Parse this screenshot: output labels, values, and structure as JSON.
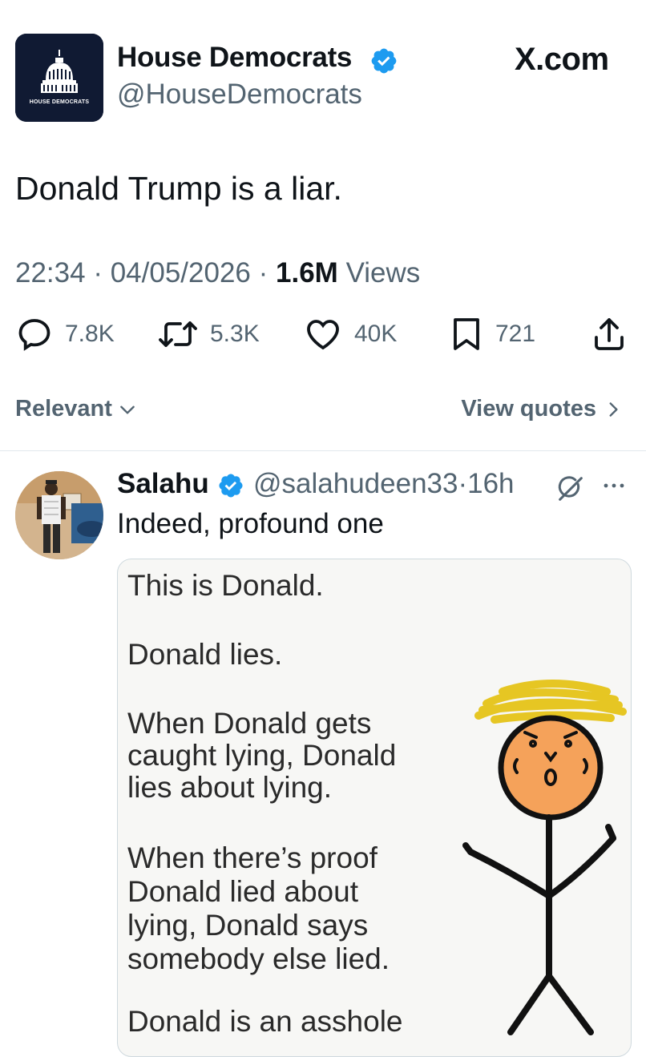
{
  "tweet": {
    "author_name": "House Democrats",
    "author_handle": "@HouseDemocrats",
    "avatar_caption": "HOUSE DEMOCRATS",
    "site_badge": "X.com",
    "text": "Donald Trump is a liar.",
    "time": "22:34",
    "date": "04/05/2026",
    "views_count": "1.6M",
    "views_label": "Views",
    "separator": "·"
  },
  "actions": {
    "replies": "7.8K",
    "reposts": "5.3K",
    "likes": "40K",
    "bookmarks": "721"
  },
  "sort_row": {
    "sort_label": "Relevant",
    "view_quotes_label": "View quotes"
  },
  "reply": {
    "author_name": "Salahu",
    "author_handle": "@salahudeen33",
    "separator": "·",
    "time_ago": "16h",
    "text": "Indeed, profound one"
  },
  "meme": {
    "lines": [
      "This is Donald.",
      "Donald lies.",
      "When Donald gets",
      "caught lying, Donald",
      "lies about lying.",
      "When there’s proof",
      "Donald lied about",
      "lying, Donald says",
      "somebody else lied.",
      "Donald is an asshole"
    ]
  },
  "colors": {
    "verified_blue": "#1d9bf0",
    "muted_text": "#536471",
    "primary_text": "#0f1419",
    "avatar_bg": "#101a33"
  },
  "icons": {
    "verified": "verified-badge-icon",
    "reply": "reply-bubble-icon",
    "repost": "repost-arrows-icon",
    "like": "heart-icon",
    "bookmark": "bookmark-icon",
    "share": "share-icon",
    "grok": "grok-icon",
    "more": "more-dots-icon",
    "chevron_down": "chevron-down-icon",
    "chevron_right": "chevron-right-icon"
  }
}
